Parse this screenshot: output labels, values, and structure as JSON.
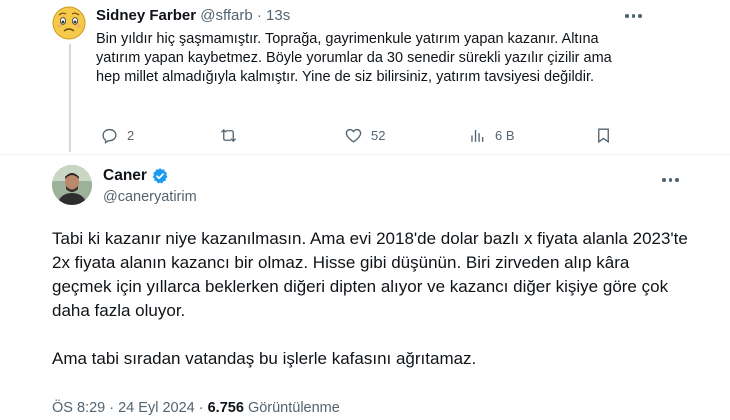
{
  "reply": {
    "display_name": "Sidney Farber",
    "handle": "@sffarb",
    "separator": "·",
    "time": "13s",
    "text": "Bin yıldır hiç şaşmamıştır. Toprağa, gayrimenkule yatırım yapan kazanır. Altına yatırım yapan kaybetmez. Böyle yorumlar da 30 senedir sürekli yazılır çizilir ama hep millet almadığıyla kalmıştır. Yine de siz bilirsiniz, yatırım tavsiyesi değildir.",
    "actions": {
      "replies": "2",
      "reposts": "",
      "likes": "52",
      "views": "6 B"
    }
  },
  "main": {
    "display_name": "Caner",
    "handle": "@caneryatirim",
    "verified_color": "#1d9bf0",
    "paragraph1": "Tabi ki kazanır niye kazanılmasın. Ama evi 2018'de dolar bazlı x fiyata alanla 2023'te 2x fiyata alanın kazancı bir olmaz. Hisse gibi düşünün. Biri zirveden alıp kâra geçmek için yıllarca beklerken diğeri dipten alıyor ve kazancı diğer kişiye göre çok daha fazla oluyor.",
    "paragraph2": "Ama tabi sıradan vatandaş bu işlerle kafasını ağrıtamaz.",
    "meta": {
      "time": "ÖS 8:29",
      "date": "24 Eyl 2024",
      "views_count": "6.756",
      "views_label": "Görüntülenme"
    }
  }
}
